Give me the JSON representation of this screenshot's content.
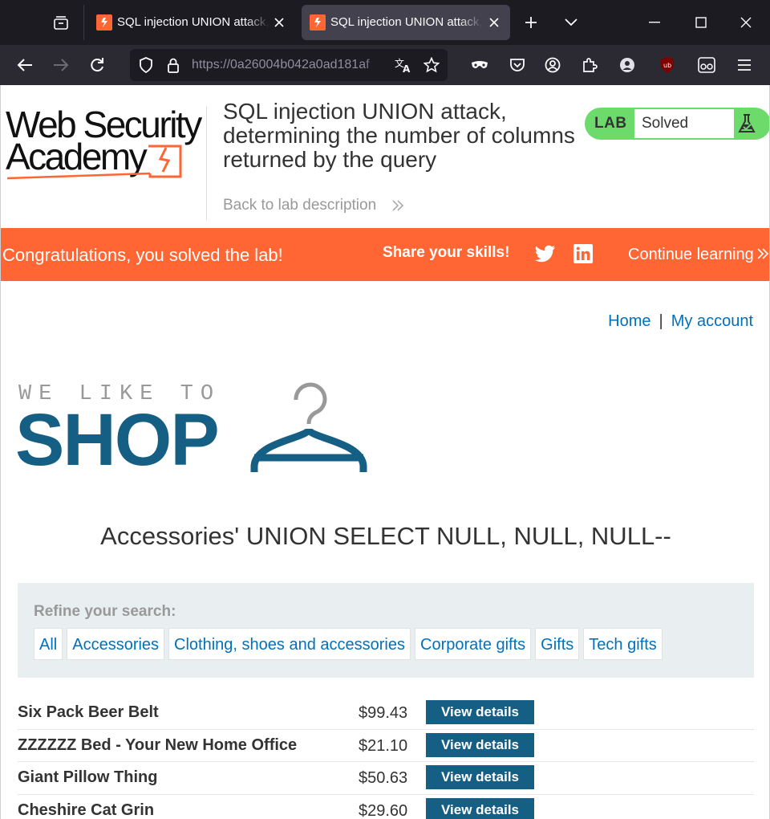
{
  "browser": {
    "tabs": [
      {
        "title": "SQL injection UNION attack, determining the number of columns",
        "active": false
      },
      {
        "title": "SQL injection UNION attack, determining the number of columns",
        "active": true
      }
    ],
    "url": "https://0a26004b042a0ad181af",
    "icons": [
      "tab-list-icon",
      "favicon-icon",
      "close-tab-icon",
      "new-tab-icon",
      "tabs-dropdown-icon",
      "minimize-icon",
      "maximize-icon",
      "close-window-icon",
      "back-icon",
      "forward-icon",
      "reload-icon",
      "shield-icon",
      "lock-icon",
      "translate-icon",
      "star-icon",
      "mask-icon",
      "pocket-icon",
      "account-icon",
      "extensions-icon",
      "profile-icon",
      "ublock-icon",
      "reader-icon",
      "menu-icon"
    ]
  },
  "header": {
    "logo_line1": "Web Security",
    "logo_line2": "Academy",
    "lab_title": "SQL injection UNION attack, determining the number of columns returned by the query",
    "back_link": "Back to lab description",
    "lab_label": "LAB",
    "lab_status": "Solved"
  },
  "banner": {
    "message": "Congratulations, you solved the lab!",
    "share": "Share your skills!",
    "continue": "Continue learning"
  },
  "nav": {
    "home": "Home",
    "separator": "|",
    "account": "My account"
  },
  "shop_logo": {
    "tagline": "WE LIKE TO",
    "word": "SHOP"
  },
  "category_title": "Accessories' UNION SELECT NULL, NULL, NULL--",
  "filter": {
    "label": "Refine your search:",
    "categories": [
      "All",
      "Accessories",
      "Clothing, shoes and accessories",
      "Corporate gifts",
      "Gifts",
      "Tech gifts"
    ]
  },
  "products": [
    {
      "name": "Six Pack Beer Belt",
      "price": "$99.43",
      "button": "View details"
    },
    {
      "name": "ZZZZZZ Bed - Your New Home Office",
      "price": "$21.10",
      "button": "View details"
    },
    {
      "name": "Giant Pillow Thing",
      "price": "$50.63",
      "button": "View details"
    },
    {
      "name": "Cheshire Cat Grin",
      "price": "$29.60",
      "button": "View details"
    }
  ],
  "colors": {
    "accent": "#ff6633",
    "link": "#0071bc",
    "shop_blue": "#155f85",
    "lab_green": "#6cdb6c"
  }
}
